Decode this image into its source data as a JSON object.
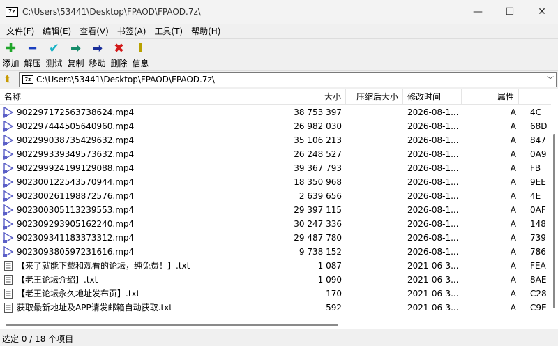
{
  "window": {
    "app_icon": "7z",
    "title": "C:\\Users\\53441\\Desktop\\FPAOD\\FPAOD.7z\\",
    "minimize_glyph": "—",
    "maximize_glyph": "☐",
    "close_glyph": "✕"
  },
  "menu": [
    "文件(F)",
    "编辑(E)",
    "查看(V)",
    "书签(A)",
    "工具(T)",
    "帮助(H)"
  ],
  "toolbar": [
    {
      "label": "添加",
      "icon": "add-icon",
      "glyph": "✚",
      "color": "#1fa52a"
    },
    {
      "label": "解压",
      "icon": "extract-icon",
      "glyph": "━",
      "color": "#1a3fbf"
    },
    {
      "label": "测试",
      "icon": "test-icon",
      "glyph": "✔",
      "color": "#19b3c6"
    },
    {
      "label": "复制",
      "icon": "copy-icon",
      "glyph": "➡",
      "color": "#178c6a"
    },
    {
      "label": "移动",
      "icon": "move-icon",
      "glyph": "➡",
      "color": "#1a2f9a"
    },
    {
      "label": "删除",
      "icon": "delete-icon",
      "glyph": "✖",
      "color": "#d21a1a"
    },
    {
      "label": "信息",
      "icon": "info-icon",
      "glyph": "i",
      "color": "#b8a100"
    }
  ],
  "address": {
    "up_glyph": "⮬",
    "icon_text": "7z",
    "path": "C:\\Users\\53441\\Desktop\\FPAOD\\FPAOD.7z\\",
    "dropdown_glyph": "﹀"
  },
  "columns": {
    "name": "名称",
    "size": "大小",
    "packed": "压缩后大小",
    "mtime": "修改时间",
    "attr": "属性",
    "crc": ""
  },
  "files": [
    {
      "name": "902297172563738624.mp4",
      "size": "38 753 397",
      "packed": "",
      "mtime": "2026-08-1...",
      "attr": "A",
      "crc": "4C",
      "type": "video"
    },
    {
      "name": "902297444505640960.mp4",
      "size": "26 982 030",
      "packed": "",
      "mtime": "2026-08-1...",
      "attr": "A",
      "crc": "68D",
      "type": "video"
    },
    {
      "name": "902299038735429632.mp4",
      "size": "35 106 213",
      "packed": "",
      "mtime": "2026-08-1...",
      "attr": "A",
      "crc": "847",
      "type": "video"
    },
    {
      "name": "902299339349573632.mp4",
      "size": "26 248 527",
      "packed": "",
      "mtime": "2026-08-1...",
      "attr": "A",
      "crc": "0A9",
      "type": "video"
    },
    {
      "name": "902299924199129088.mp4",
      "size": "39 367 793",
      "packed": "",
      "mtime": "2026-08-1...",
      "attr": "A",
      "crc": "FB",
      "type": "video"
    },
    {
      "name": "902300122543570944.mp4",
      "size": "18 350 968",
      "packed": "",
      "mtime": "2026-08-1...",
      "attr": "A",
      "crc": "9EE",
      "type": "video"
    },
    {
      "name": "902300261198872576.mp4",
      "size": "2 639 656",
      "packed": "",
      "mtime": "2026-08-1...",
      "attr": "A",
      "crc": "4E",
      "type": "video"
    },
    {
      "name": "902300305113239553.mp4",
      "size": "29 397 115",
      "packed": "",
      "mtime": "2026-08-1...",
      "attr": "A",
      "crc": "0AF",
      "type": "video"
    },
    {
      "name": "902309293905162240.mp4",
      "size": "30 247 336",
      "packed": "",
      "mtime": "2026-08-1...",
      "attr": "A",
      "crc": "148",
      "type": "video"
    },
    {
      "name": "902309341183373312.mp4",
      "size": "29 487 780",
      "packed": "",
      "mtime": "2026-08-1...",
      "attr": "A",
      "crc": "739",
      "type": "video"
    },
    {
      "name": "902309380597231616.mp4",
      "size": "9 738 152",
      "packed": "",
      "mtime": "2026-08-1...",
      "attr": "A",
      "crc": "786",
      "type": "video"
    },
    {
      "name": "【来了就能下载和观看的论坛，纯免费！】.txt",
      "size": "1 087",
      "packed": "",
      "mtime": "2021-06-3...",
      "attr": "A",
      "crc": "FEA",
      "type": "text"
    },
    {
      "name": "【老王论坛介绍】.txt",
      "size": "1 090",
      "packed": "",
      "mtime": "2021-06-3...",
      "attr": "A",
      "crc": "8AE",
      "type": "text"
    },
    {
      "name": "【老王论坛永久地址发布页】.txt",
      "size": "170",
      "packed": "",
      "mtime": "2021-06-3...",
      "attr": "A",
      "crc": "C28",
      "type": "text"
    },
    {
      "name": "获取最新地址及APP请发邮箱自动获取.txt",
      "size": "592",
      "packed": "",
      "mtime": "2021-06-3...",
      "attr": "A",
      "crc": "C9E",
      "type": "text"
    }
  ],
  "status": "选定 0 / 18 个项目",
  "colors": {
    "video_icon": "#5b5fc7",
    "text_icon": "#555555"
  }
}
